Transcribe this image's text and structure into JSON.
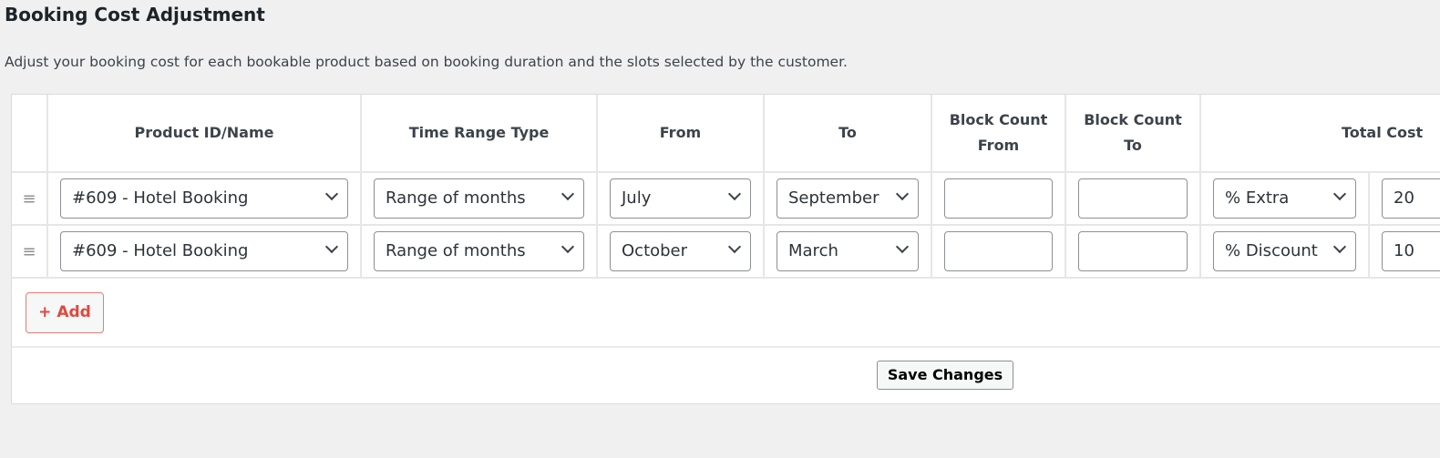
{
  "page": {
    "title": "Booking Cost Adjustment",
    "description": "Adjust your booking cost for each bookable product based on booking duration and the slots selected by the customer."
  },
  "table": {
    "headers": {
      "product": "Product ID/Name",
      "time_range_type": "Time Range Type",
      "from": "From",
      "to": "To",
      "block_count_from": "Block Count From",
      "block_count_to": "Block Count To",
      "total_cost": "Total Cost"
    },
    "rows": [
      {
        "product": "#609 - Hotel Booking",
        "time_range_type": "Range of months",
        "from": "July",
        "to": "September",
        "block_count_from": "",
        "block_count_to": "",
        "cost_type": "% Extra",
        "cost_value": "20"
      },
      {
        "product": "#609 - Hotel Booking",
        "time_range_type": "Range of months",
        "from": "October",
        "to": "March",
        "block_count_from": "",
        "block_count_to": "",
        "cost_type": "% Discount",
        "cost_value": "10"
      }
    ]
  },
  "actions": {
    "add_label": "+ Add",
    "save_label": "Save Changes"
  },
  "icons": {
    "drag": "drag-handle-icon",
    "dropdown": "chevron-down-icon"
  },
  "colors": {
    "add_accent": "#e2483d"
  }
}
